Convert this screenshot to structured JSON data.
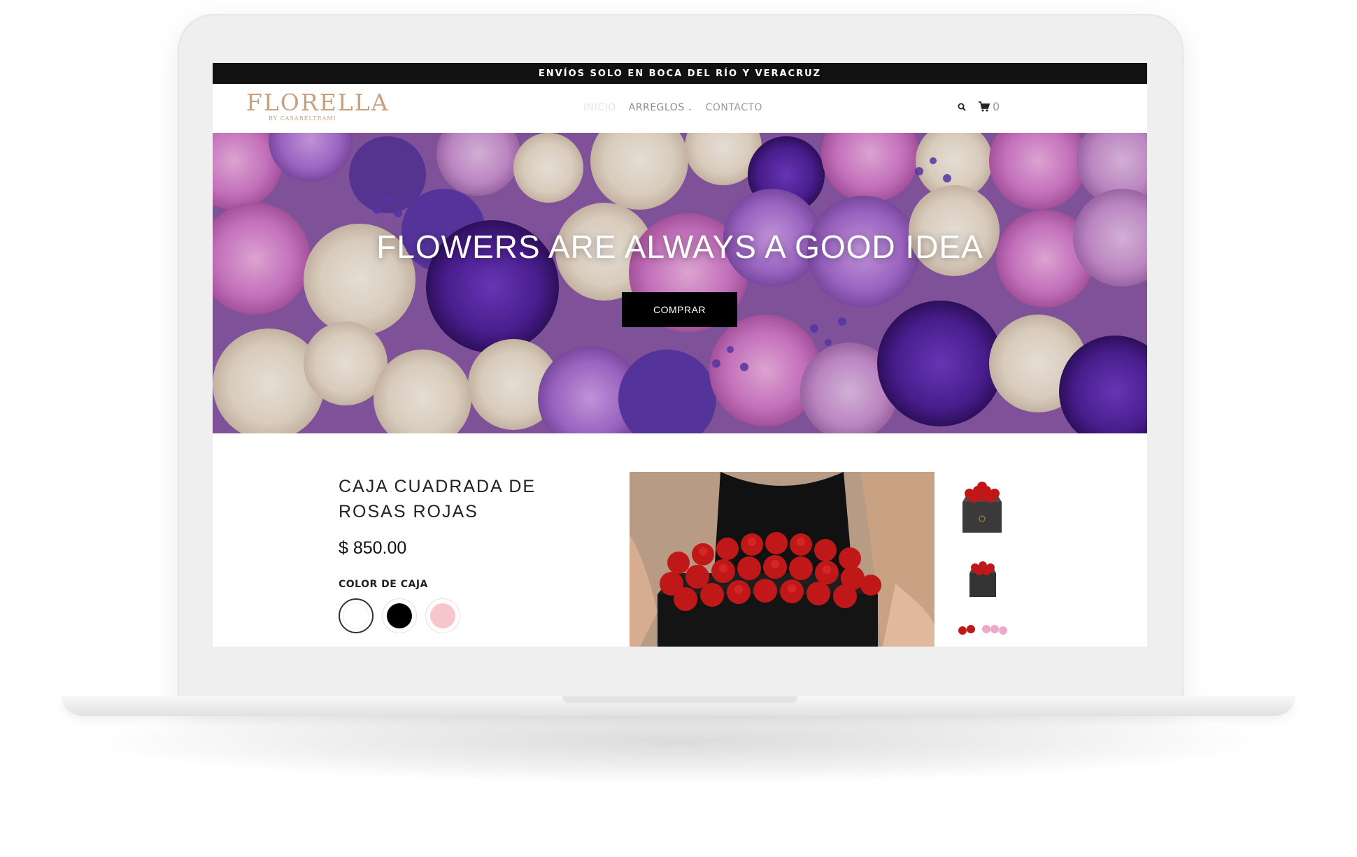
{
  "announcement": "ENVÍOS SOLO EN BOCA DEL RÍO Y VERACRUZ",
  "logo": {
    "main": "FLORELLA",
    "sub": "BY CASABELTRAMI"
  },
  "nav": {
    "items": [
      "INICIO",
      "ARREGLOS",
      "CONTACTO"
    ]
  },
  "cart": {
    "count": "0"
  },
  "hero": {
    "title": "FLOWERS ARE ALWAYS A GOOD IDEA",
    "button": "COMPRAR"
  },
  "product": {
    "title": "CAJA CUADRADA DE ROSAS ROJAS",
    "price": "$ 850.00",
    "color_label": "COLOR DE CAJA",
    "swatches": [
      {
        "color": "#ffffff",
        "selected": true
      },
      {
        "color": "#000000",
        "selected": false
      },
      {
        "color": "#f6c6cc",
        "selected": false
      }
    ]
  },
  "icons": [
    "search-icon",
    "cart-icon",
    "chevron-down-icon"
  ],
  "colors": {
    "accent_logo": "#c8a07f",
    "announcement_bg": "#111111",
    "button_bg": "#000000"
  }
}
